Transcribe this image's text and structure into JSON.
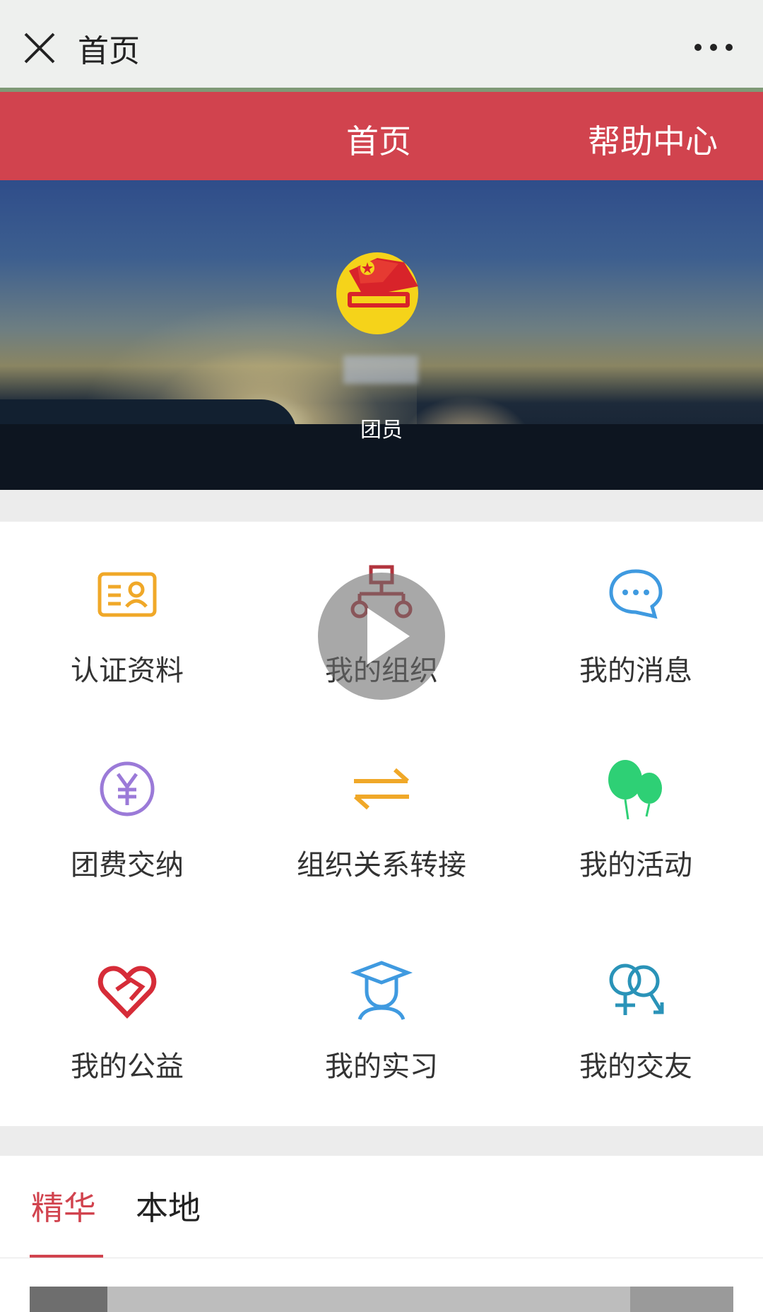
{
  "appbar": {
    "title": "首页",
    "close_icon": "close-icon",
    "more_icon": "more-icon"
  },
  "nav": {
    "home": "首页",
    "help": "帮助中心",
    "bg_color": "#d1434e"
  },
  "profile": {
    "role": "团员",
    "emblem_icon": "youth-league-emblem"
  },
  "grid": {
    "items": [
      {
        "label": "认证资料",
        "icon": "id-card-icon",
        "color": "#f0a828"
      },
      {
        "label": "我的组织",
        "icon": "org-chart-icon",
        "color": "#b2343e"
      },
      {
        "label": "我的消息",
        "icon": "message-icon",
        "color": "#3f9ae0"
      },
      {
        "label": "团费交纳",
        "icon": "yuan-coin-icon",
        "color": "#9b7ad8"
      },
      {
        "label": "组织关系转接",
        "icon": "transfer-arrows-icon",
        "color": "#f0a828"
      },
      {
        "label": "我的活动",
        "icon": "balloons-icon",
        "color": "#2ed075"
      },
      {
        "label": "我的公益",
        "icon": "heart-hand-icon",
        "color": "#d62c38"
      },
      {
        "label": "我的实习",
        "icon": "graduate-icon",
        "color": "#3f9ae0"
      },
      {
        "label": "我的交友",
        "icon": "gender-icon",
        "color": "#2a93b8"
      }
    ]
  },
  "video_overlay": {
    "icon": "play-icon"
  },
  "tabs": {
    "items": [
      "精华",
      "本地"
    ],
    "active": "精华"
  }
}
